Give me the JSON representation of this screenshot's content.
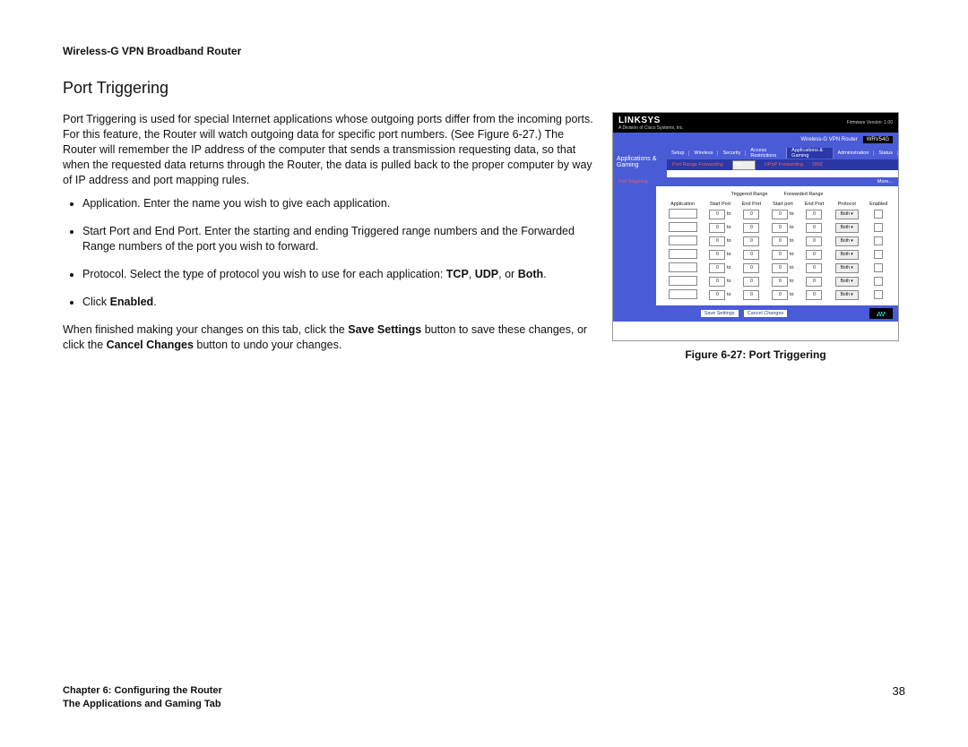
{
  "header": "Wireless-G VPN Broadband Router",
  "title": "Port Triggering",
  "intro": "Port Triggering is used for special Internet applications whose outgoing ports differ from the incoming ports. For this feature, the Router will watch outgoing data for specific port numbers. (See Figure 6-27.) The Router will remember the IP address of the computer that sends a transmission requesting data, so that when the requested data returns through the Router, the data is pulled back to the proper computer by way of IP address and port mapping rules.",
  "bullets": {
    "b1": "Application. Enter the name you wish to give each application.",
    "b2": "Start Port and End Port. Enter the starting and ending Triggered range numbers and the Forwarded Range numbers of the port you wish to forward.",
    "b3_pre": "Protocol. Select the type of protocol you wish to use for each application: ",
    "b3_tcp": "TCP",
    "b3_sep1": ", ",
    "b3_udp": "UDP",
    "b3_sep2": ", or ",
    "b3_both": "Both",
    "b3_end": ".",
    "b4_pre": "Click ",
    "b4_en": "Enabled",
    "b4_end": "."
  },
  "closing_pre": "When finished making your changes on this tab, click the ",
  "closing_save": "Save Settings",
  "closing_mid": " button to save these changes, or click the ",
  "closing_cancel": "Cancel Changes",
  "closing_end": " button to undo your changes.",
  "figure_caption": "Figure 6-27: Port Triggering",
  "footer": {
    "line1": "Chapter 6: Configuring the Router",
    "line2": "The Applications and Gaming Tab",
    "page": "38"
  },
  "router": {
    "brand": "LINKSYS",
    "brand_sub": "A Division of Cisco Systems, Inc.",
    "fw": "Firmware Version: 1.00",
    "product": "Wireless-G VPN Router",
    "model": "WRV54G",
    "side_title": "Applications & Gaming",
    "tabs": [
      "Setup",
      "Wireless",
      "Security",
      "Access Restrictions",
      "Applications & Gaming",
      "Administration",
      "Status"
    ],
    "active_tab_index": 4,
    "subtabs": [
      "Port Range Forwarding",
      "Port Triggering",
      "UPnP Forwarding",
      "DMZ"
    ],
    "active_subtab_index": 1,
    "left_label": "Port Triggering",
    "more": "More...",
    "group1": "Triggered Range",
    "group2": "Forwarded Range",
    "cols": [
      "Application",
      "Start Port",
      "End Port",
      "Start port",
      "End Port",
      "Protocol",
      "Enabled"
    ],
    "to": "to",
    "default_val": "0",
    "select_val": "Both",
    "rows": 7,
    "save": "Save Settings",
    "cancel": "Cancel Changes",
    "cisco": "CISCO SYSTEMS"
  }
}
